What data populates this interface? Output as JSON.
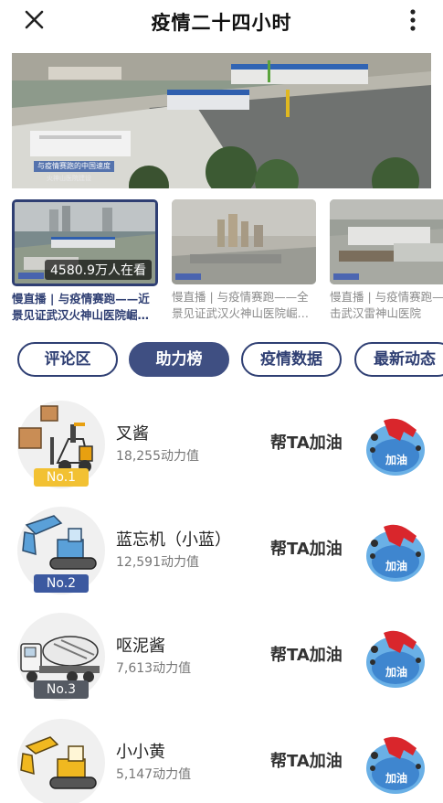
{
  "header": {
    "title": "疫情二十四小时",
    "close_icon": "close-icon",
    "more_icon": "more-vertical-icon"
  },
  "hero": {
    "caption_tag": "与疫情赛跑的中国速度",
    "caption_sub": "火神山医院建设"
  },
  "streams": [
    {
      "viewers": "4580.9万人在看",
      "desc": "慢直播 | 与疫情赛跑——近景见证武汉火神山医院崛…",
      "active": true
    },
    {
      "desc": "慢直播 | 与疫情赛跑——全景见证武汉火神山医院崛…",
      "active": false
    },
    {
      "desc": "慢直播 | 与疫情赛跑——直击武汉雷神山医院",
      "active": false
    }
  ],
  "tabs": [
    {
      "label": "评论区",
      "active": false
    },
    {
      "label": "助力榜",
      "active": true
    },
    {
      "label": "疫情数据",
      "active": false
    },
    {
      "label": "最新动态",
      "active": false
    }
  ],
  "ranking": [
    {
      "rank": "No.1",
      "name": "叉酱",
      "power": "18,255动力值",
      "cheer": "帮TA加油",
      "fuel_label": "加油",
      "machine": "forklift"
    },
    {
      "rank": "No.2",
      "name": "蓝忘机（小蓝）",
      "power": "12,591动力值",
      "cheer": "帮TA加油",
      "fuel_label": "加油",
      "machine": "excavator-blue"
    },
    {
      "rank": "No.3",
      "name": "呕泥酱",
      "power": "7,613动力值",
      "cheer": "帮TA加油",
      "fuel_label": "加油",
      "machine": "cement-mixer"
    },
    {
      "rank": "",
      "name": "小小黄",
      "power": "5,147动力值",
      "cheer": "帮TA加油",
      "fuel_label": "加油",
      "machine": "excavator-yellow"
    }
  ],
  "colors": {
    "accent": "#2f3f73",
    "accent_active": "#3f4f82",
    "badge_gold": "#f2c133",
    "badge_blue": "#3c59a0",
    "badge_dark": "#555a63",
    "fuel_red": "#d9262c",
    "fuel_blue": "#4e93d8"
  }
}
